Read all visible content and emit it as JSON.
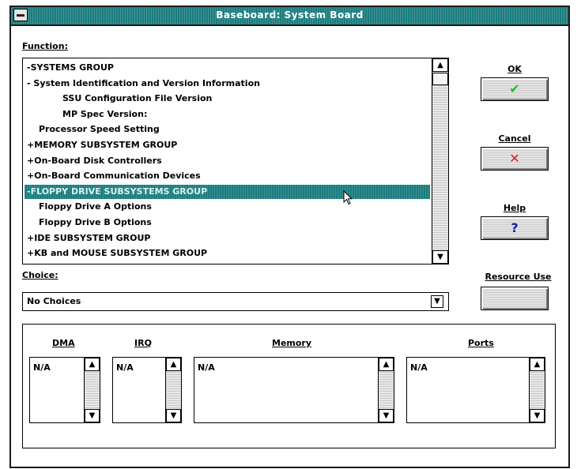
{
  "window": {
    "title": "Baseboard: System Board"
  },
  "function_section": {
    "label": "Function:",
    "items": [
      {
        "text": "-SYSTEMS GROUP",
        "indent": 0,
        "selected": false
      },
      {
        "text": "-     System Identification and Version Information",
        "indent": 0,
        "selected": false
      },
      {
        "text": "SSU Configuration File Version",
        "indent": 3,
        "selected": false
      },
      {
        "text": "MP Spec Version:",
        "indent": 3,
        "selected": false
      },
      {
        "text": "Processor Speed Setting",
        "indent": 1,
        "selected": false
      },
      {
        "text": "+MEMORY SUBSYSTEM GROUP",
        "indent": 0,
        "selected": false
      },
      {
        "text": "+On-Board Disk Controllers",
        "indent": 0,
        "selected": false
      },
      {
        "text": "+On-Board Communication Devices",
        "indent": 0,
        "selected": false
      },
      {
        "text": "-FLOPPY DRIVE SUBSYSTEMS GROUP",
        "indent": 0,
        "selected": true
      },
      {
        "text": "Floppy Drive A Options",
        "indent": 1,
        "selected": false
      },
      {
        "text": "Floppy Drive B Options",
        "indent": 1,
        "selected": false
      },
      {
        "text": "+IDE SUBSYSTEM GROUP",
        "indent": 0,
        "selected": false
      },
      {
        "text": "+KB and MOUSE SUBSYSTEM GROUP",
        "indent": 0,
        "selected": false
      }
    ]
  },
  "choice_section": {
    "label": "Choice:",
    "value": "No Choices"
  },
  "buttons": {
    "ok": {
      "label": "OK",
      "glyph": "✔",
      "color": "#1fbf1f"
    },
    "cancel": {
      "label": "Cancel",
      "glyph": "✕",
      "color": "#d02020"
    },
    "help": {
      "label": "Help",
      "glyph": "?",
      "color": "#1a1ab0"
    },
    "resource_use": {
      "label": "Resource Use"
    }
  },
  "resources": {
    "dma": {
      "label": "DMA",
      "value": "N/A"
    },
    "irq": {
      "label": "IRQ",
      "value": "N/A"
    },
    "memory": {
      "label": "Memory",
      "value": "N/A"
    },
    "ports": {
      "label": "Ports",
      "value": "N/A"
    }
  },
  "colors": {
    "title_bar": "#1b7d7d",
    "selection": "#1b7d7d"
  }
}
